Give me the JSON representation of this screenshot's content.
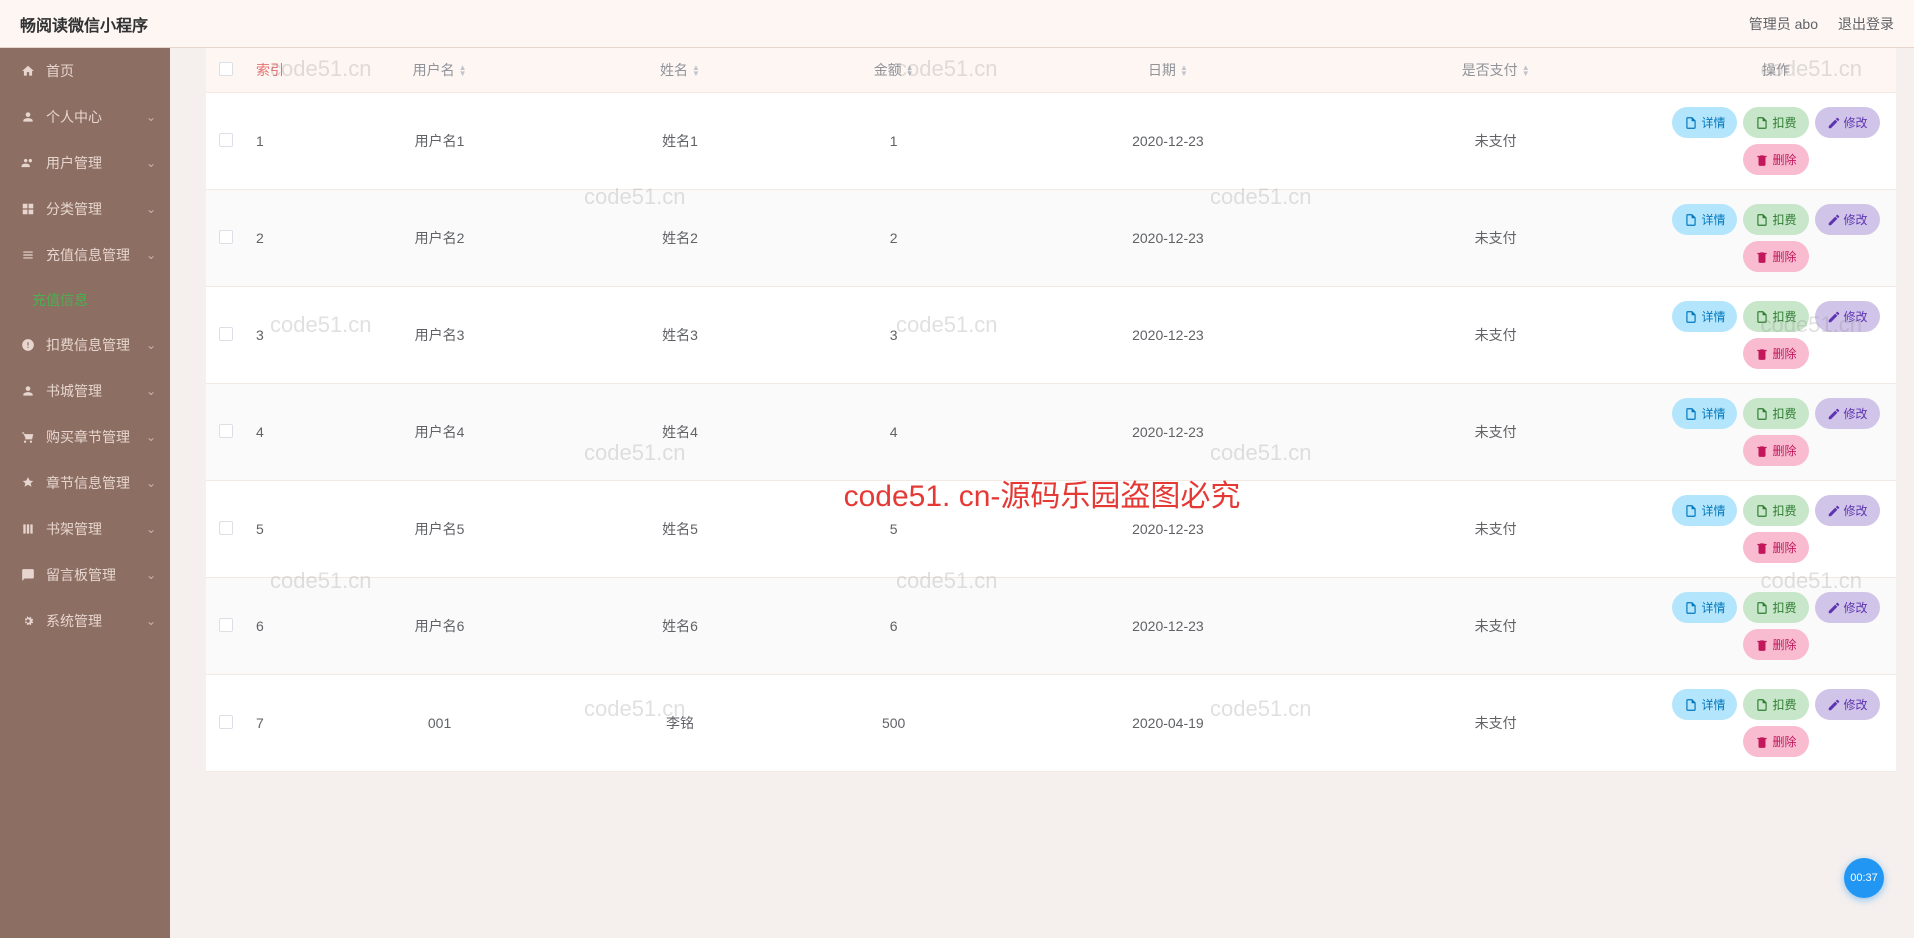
{
  "header": {
    "title": "畅阅读微信小程序",
    "admin_label": "管理员 abo",
    "logout_label": "退出登录"
  },
  "sidebar": {
    "items": [
      {
        "icon": "home",
        "label": "首页",
        "expand": false
      },
      {
        "icon": "user",
        "label": "个人中心",
        "expand": true
      },
      {
        "icon": "users",
        "label": "用户管理",
        "expand": true
      },
      {
        "icon": "category",
        "label": "分类管理",
        "expand": true
      },
      {
        "icon": "recharge",
        "label": "充值信息管理",
        "expand": true,
        "open": true,
        "sub": [
          {
            "label": "充值信息"
          }
        ]
      },
      {
        "icon": "deduct",
        "label": "扣费信息管理",
        "expand": true
      },
      {
        "icon": "book",
        "label": "书城管理",
        "expand": true
      },
      {
        "icon": "cart",
        "label": "购买章节管理",
        "expand": true
      },
      {
        "icon": "chapter",
        "label": "章节信息管理",
        "expand": true
      },
      {
        "icon": "shelf",
        "label": "书架管理",
        "expand": true
      },
      {
        "icon": "message",
        "label": "留言板管理",
        "expand": true
      },
      {
        "icon": "system",
        "label": "系统管理",
        "expand": true
      }
    ]
  },
  "table": {
    "headers": {
      "index": "索引",
      "username": "用户名",
      "name": "姓名",
      "amount": "金额",
      "date": "日期",
      "paid": "是否支付",
      "action": "操作"
    },
    "action_labels": {
      "detail": "详情",
      "deduct": "扣费",
      "edit": "修改",
      "delete": "删除"
    },
    "rows": [
      {
        "index": "1",
        "username": "用户名1",
        "name": "姓名1",
        "amount": "1",
        "date": "2020-12-23",
        "paid": "未支付"
      },
      {
        "index": "2",
        "username": "用户名2",
        "name": "姓名2",
        "amount": "2",
        "date": "2020-12-23",
        "paid": "未支付"
      },
      {
        "index": "3",
        "username": "用户名3",
        "name": "姓名3",
        "amount": "3",
        "date": "2020-12-23",
        "paid": "未支付"
      },
      {
        "index": "4",
        "username": "用户名4",
        "name": "姓名4",
        "amount": "4",
        "date": "2020-12-23",
        "paid": "未支付"
      },
      {
        "index": "5",
        "username": "用户名5",
        "name": "姓名5",
        "amount": "5",
        "date": "2020-12-23",
        "paid": "未支付"
      },
      {
        "index": "6",
        "username": "用户名6",
        "name": "姓名6",
        "amount": "6",
        "date": "2020-12-23",
        "paid": "未支付"
      },
      {
        "index": "7",
        "username": "001",
        "name": "李铭",
        "amount": "500",
        "date": "2020-04-19",
        "paid": "未支付"
      }
    ]
  },
  "watermarks": {
    "text": "code51.cn",
    "big": "code51. cn-源码乐园盗图必究"
  },
  "timer": "00:37"
}
